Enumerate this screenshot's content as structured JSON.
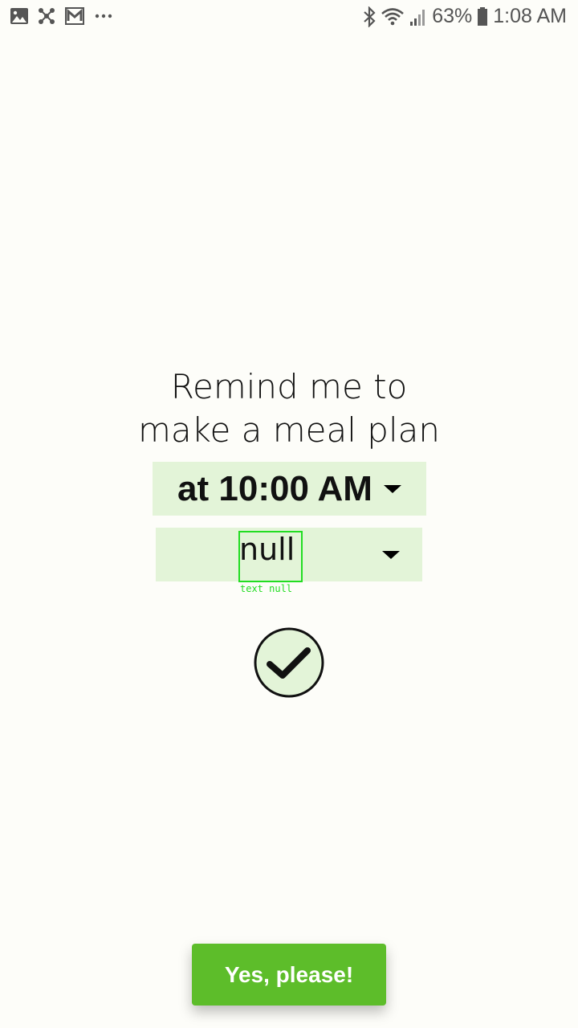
{
  "status_bar": {
    "battery_percent": "63%",
    "time": "1:08 AM",
    "left_icons": [
      "image-icon",
      "network-icon",
      "gmail-icon",
      "more-icon"
    ],
    "right_icons": [
      "bluetooth-icon",
      "wifi-icon",
      "signal-icon",
      "battery-icon"
    ]
  },
  "reminder": {
    "title_line1": "Remind me to",
    "title_line2": "make a meal plan",
    "time_value": "at 10:00 AM",
    "day_value": "null",
    "debug_label": "text null"
  },
  "actions": {
    "confirm_label": "Yes, please!"
  },
  "colors": {
    "background": "#fdfdf9",
    "dropdown_bg": "#e3f4d8",
    "primary_button": "#5dbd2a",
    "debug_outline": "#22dd22"
  }
}
